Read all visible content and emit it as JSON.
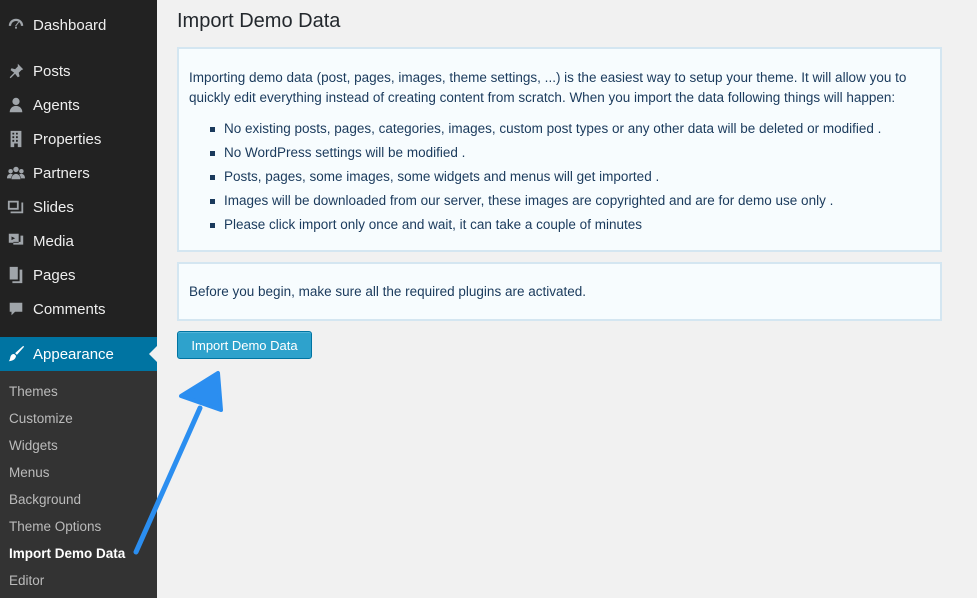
{
  "sidebar": {
    "items": [
      {
        "label": "Dashboard",
        "icon": "dashboard-icon"
      },
      {
        "label": "Posts",
        "icon": "pin-icon"
      },
      {
        "label": "Agents",
        "icon": "user-icon"
      },
      {
        "label": "Properties",
        "icon": "building-icon"
      },
      {
        "label": "Partners",
        "icon": "group-icon"
      },
      {
        "label": "Slides",
        "icon": "slides-icon"
      },
      {
        "label": "Media",
        "icon": "media-icon"
      },
      {
        "label": "Pages",
        "icon": "pages-icon"
      },
      {
        "label": "Comments",
        "icon": "comment-icon"
      },
      {
        "label": "Appearance",
        "icon": "brush-icon"
      }
    ],
    "submenu": [
      "Themes",
      "Customize",
      "Widgets",
      "Menus",
      "Background",
      "Theme Options",
      "Import Demo Data",
      "Editor"
    ]
  },
  "main": {
    "title": "Import Demo Data",
    "intro": "Importing demo data (post, pages, images, theme settings, ...) is the easiest way to setup your theme. It will allow you to quickly edit everything instead of creating content from scratch. When you import the data following things will happen:",
    "bullets": [
      "No existing posts, pages, categories, images, custom post types or any other data will be deleted or modified .",
      "No WordPress settings will be modified .",
      "Posts, pages, some images, some widgets and menus will get imported .",
      "Images will be downloaded from our server, these images are copyrighted and are for demo use only .",
      "Please click import only once and wait, it can take a couple of minutes"
    ],
    "notice": "Before you begin, make sure all the required plugins are activated.",
    "button_label": "Import Demo Data"
  },
  "colors": {
    "sidebar_bg": "#222222",
    "active_bg": "#0074a2",
    "button_bg": "#2ea2cc",
    "arrow": "#2b8ef0"
  }
}
